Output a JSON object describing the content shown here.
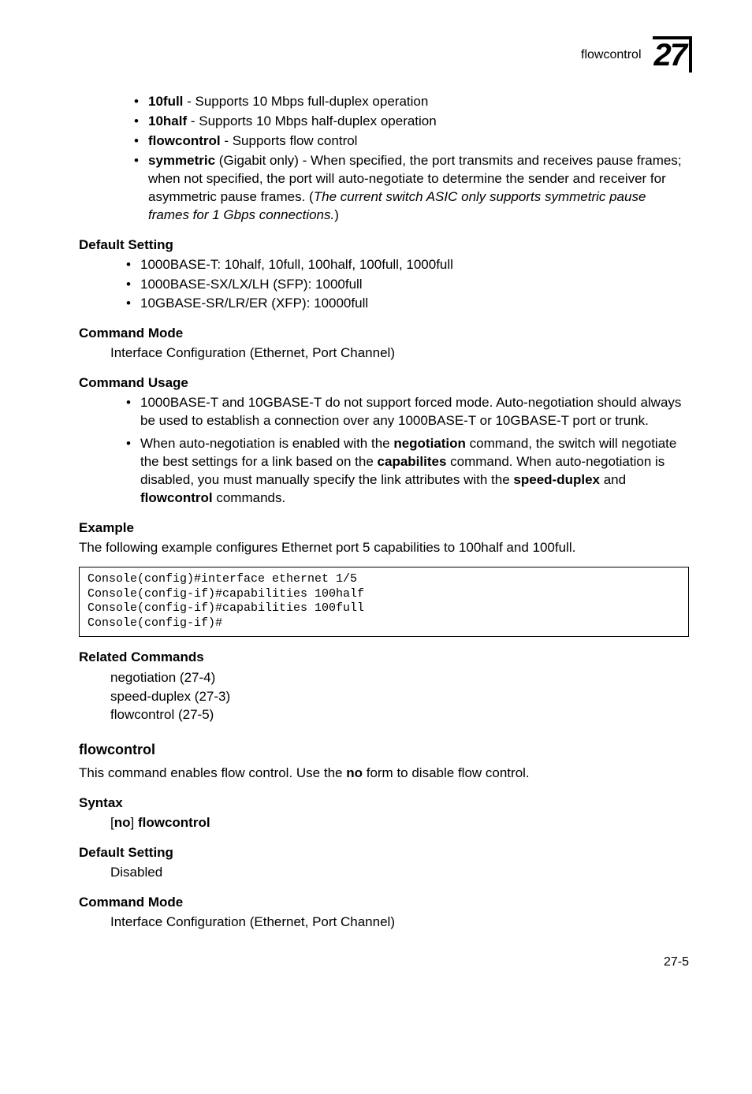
{
  "header": {
    "running": "flowcontrol",
    "chapter": "27"
  },
  "intro_bullets": [
    {
      "term": "10full",
      "desc": " - Supports 10 Mbps full-duplex operation"
    },
    {
      "term": "10half",
      "desc": " - Supports 10 Mbps half-duplex operation"
    },
    {
      "term": "flowcontrol",
      "desc": " - Supports flow control"
    },
    {
      "term": "symmetric",
      "desc_lead": " (Gigabit only) - When specified, the port transmits and receives pause frames; when not specified, the port will auto-negotiate to determine the sender and receiver for asymmetric pause frames. (",
      "desc_italic": "The current switch ASIC only supports symmetric pause frames for 1 Gbps connections.",
      "desc_tail": ")"
    }
  ],
  "default_setting": {
    "title": "Default Setting",
    "items": [
      "1000BASE-T: 10half, 10full, 100half, 100full, 1000full",
      "1000BASE-SX/LX/LH (SFP): 1000full",
      "10GBASE-SR/LR/ER (XFP): 10000full"
    ]
  },
  "command_mode": {
    "title": "Command Mode",
    "text": "Interface Configuration (Ethernet, Port Channel)"
  },
  "command_usage": {
    "title": "Command Usage",
    "items": [
      {
        "plain": "1000BASE-T and 10GBASE-T do not support forced mode. Auto-negotiation should always be used to establish a connection over any 1000BASE-T or 10GBASE-T port or trunk."
      },
      {
        "rich_pre": "When auto-negotiation is enabled with the ",
        "b1": "negotiation",
        "mid1": " command, the switch will negotiate the best settings for a link based on the ",
        "b2": "capabilites",
        "mid2": " command. When auto-negotiation is disabled, you must manually specify the link attributes with the ",
        "b3": "speed-duplex",
        "mid3": " and ",
        "b4": "flowcontrol",
        "tail": " commands."
      }
    ]
  },
  "example": {
    "title": "Example",
    "intro": "The following example configures Ethernet port 5 capabilities to 100half and 100full.",
    "code": "Console(config)#interface ethernet 1/5\nConsole(config-if)#capabilities 100half\nConsole(config-if)#capabilities 100full\nConsole(config-if)#"
  },
  "related": {
    "title": "Related Commands",
    "lines": [
      "negotiation (27-4)",
      "speed-duplex (27-3)",
      "flowcontrol (27-5)"
    ]
  },
  "flowcontrol": {
    "heading": "flowcontrol",
    "intro_pre": "This command enables flow control. Use the ",
    "intro_bold": "no",
    "intro_post": " form to disable flow control.",
    "syntax_title": "Syntax",
    "syntax_pre": "[",
    "syntax_no": "no",
    "syntax_mid": "] ",
    "syntax_cmd": "flowcontrol",
    "default_title": "Default Setting",
    "default_text": "Disabled",
    "mode_title": "Command Mode",
    "mode_text": "Interface Configuration (Ethernet, Port Channel)"
  },
  "footer": "27-5"
}
